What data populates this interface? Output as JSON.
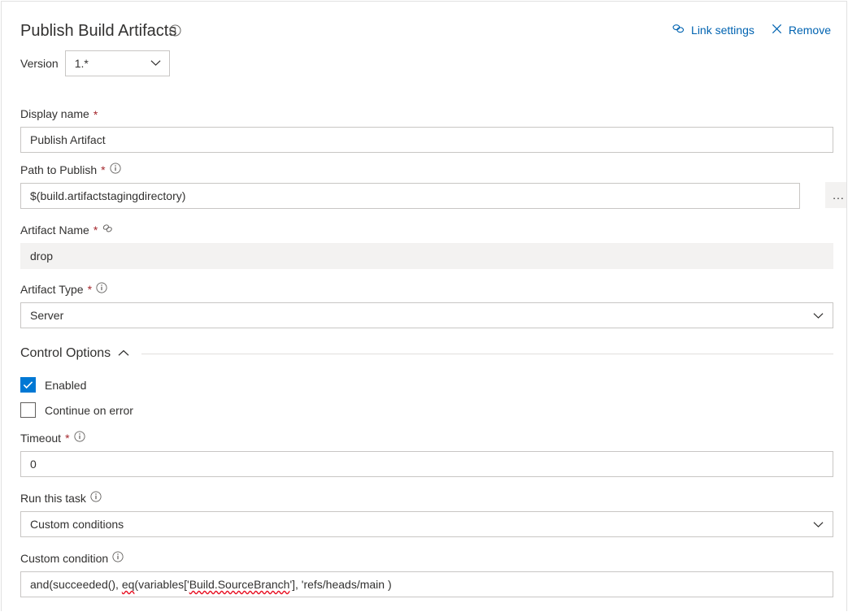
{
  "header": {
    "title": "Publish Build Artifacts",
    "info_icon": "info-icon",
    "link_settings_label": "Link settings",
    "link_settings_icon": "link-chain-icon",
    "remove_label": "Remove",
    "remove_icon": "close-x-icon"
  },
  "version": {
    "label": "Version",
    "value": "1.*",
    "chevron_icon": "chevron-down-icon"
  },
  "fields": {
    "display_name": {
      "label": "Display name",
      "required": "*",
      "value": "Publish Artifact"
    },
    "path_to_publish": {
      "label": "Path to Publish",
      "required": "*",
      "info_icon": "info-icon",
      "value": "$(build.artifactstagingdirectory)",
      "browse_label": "...",
      "browse_icon": "ellipsis-icon"
    },
    "artifact_name": {
      "label": "Artifact Name",
      "required": "*",
      "link_icon": "link-chain-icon",
      "value": "drop",
      "disabled": true
    },
    "artifact_type": {
      "label": "Artifact Type",
      "required": "*",
      "info_icon": "info-icon",
      "value": "Server",
      "chevron_icon": "chevron-down-icon"
    }
  },
  "control_options": {
    "title": "Control Options",
    "chevron_icon": "chevron-up-icon",
    "enabled": {
      "label": "Enabled",
      "checked": true
    },
    "continue_on_error": {
      "label": "Continue on error",
      "checked": false
    },
    "timeout": {
      "label": "Timeout",
      "required": "*",
      "info_icon": "info-icon",
      "value": "0"
    },
    "run_this_task": {
      "label": "Run this task",
      "info_icon": "info-icon",
      "value": "Custom conditions",
      "chevron_icon": "chevron-down-icon"
    },
    "custom_condition": {
      "label": "Custom condition",
      "info_icon": "info-icon",
      "value": "and(succeeded(), eq(variables['Build.SourceBranch'], 'refs/heads/main )",
      "segment_1": "and(succeeded(), ",
      "segment_misspelled_1": "eq",
      "segment_2": "(variables['",
      "segment_misspelled_2": "Build.SourceBranch",
      "segment_3": "'], 'refs/heads/main )"
    }
  },
  "colors": {
    "accent": "#0078d4",
    "link": "#0063b1",
    "required_asterisk": "#a4262c",
    "text": "#323130",
    "border": "#c8c6c4",
    "disabled_bg": "#f3f2f1",
    "spellcheck": "#e81123"
  }
}
